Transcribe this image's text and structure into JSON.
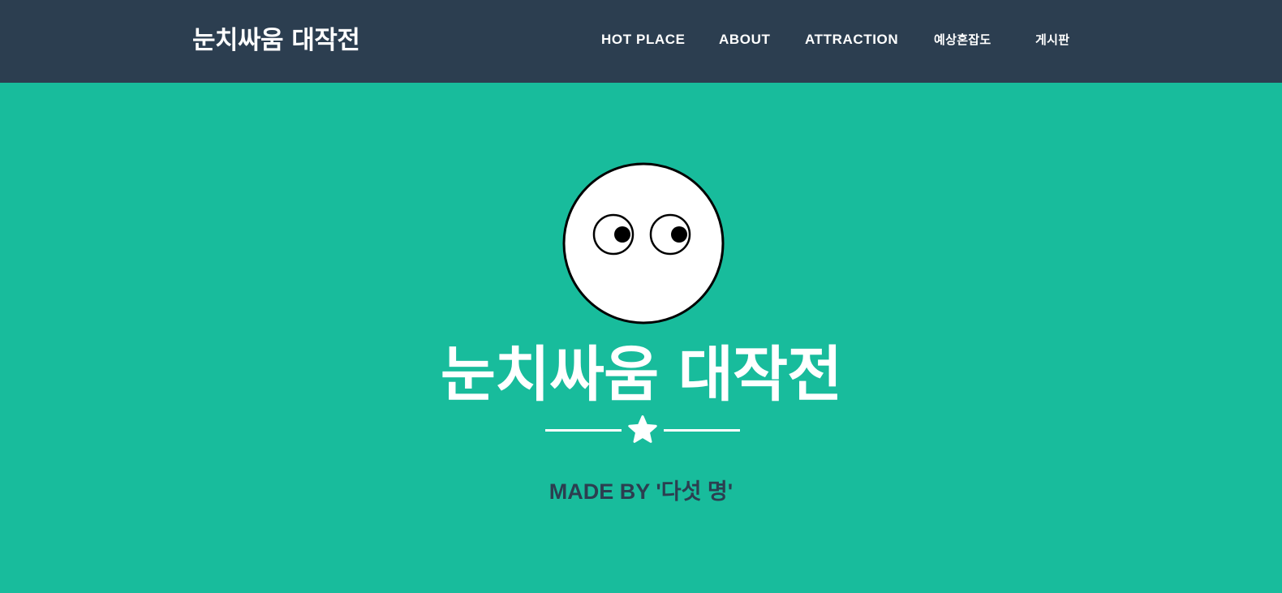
{
  "navbar": {
    "brand": "눈치싸움 대작전",
    "items": [
      {
        "label": "HOT PLACE"
      },
      {
        "label": "ABOUT"
      },
      {
        "label": "ATTRACTION"
      },
      {
        "label": "예상혼잡도"
      },
      {
        "label": "게시판"
      }
    ]
  },
  "hero": {
    "icon": "googly-eyes-face-icon",
    "divider_icon": "star-icon",
    "title": "눈치싸움 대작전",
    "subtitle": "MADE BY '다섯 명'"
  },
  "colors": {
    "navbar_bg": "#2c3e50",
    "hero_bg": "#18bc9c",
    "text_light": "#ffffff",
    "text_dark": "#2c3e50"
  }
}
